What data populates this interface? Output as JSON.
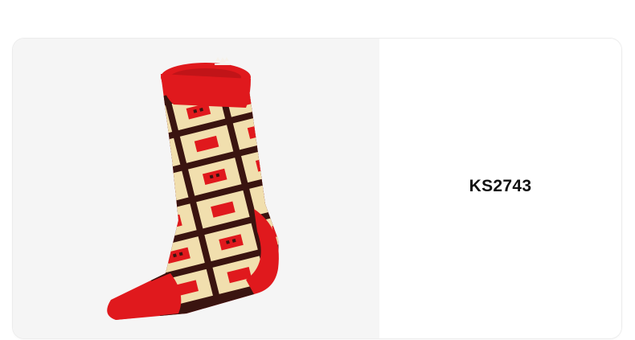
{
  "product": {
    "code": "KS2743",
    "image_subject": "sock-image",
    "colors": {
      "card_left_bg": "#f5f5f5",
      "sock_red": "#e0191d",
      "pattern_cream": "#f1dfae",
      "pattern_dark": "#3a1410"
    }
  }
}
